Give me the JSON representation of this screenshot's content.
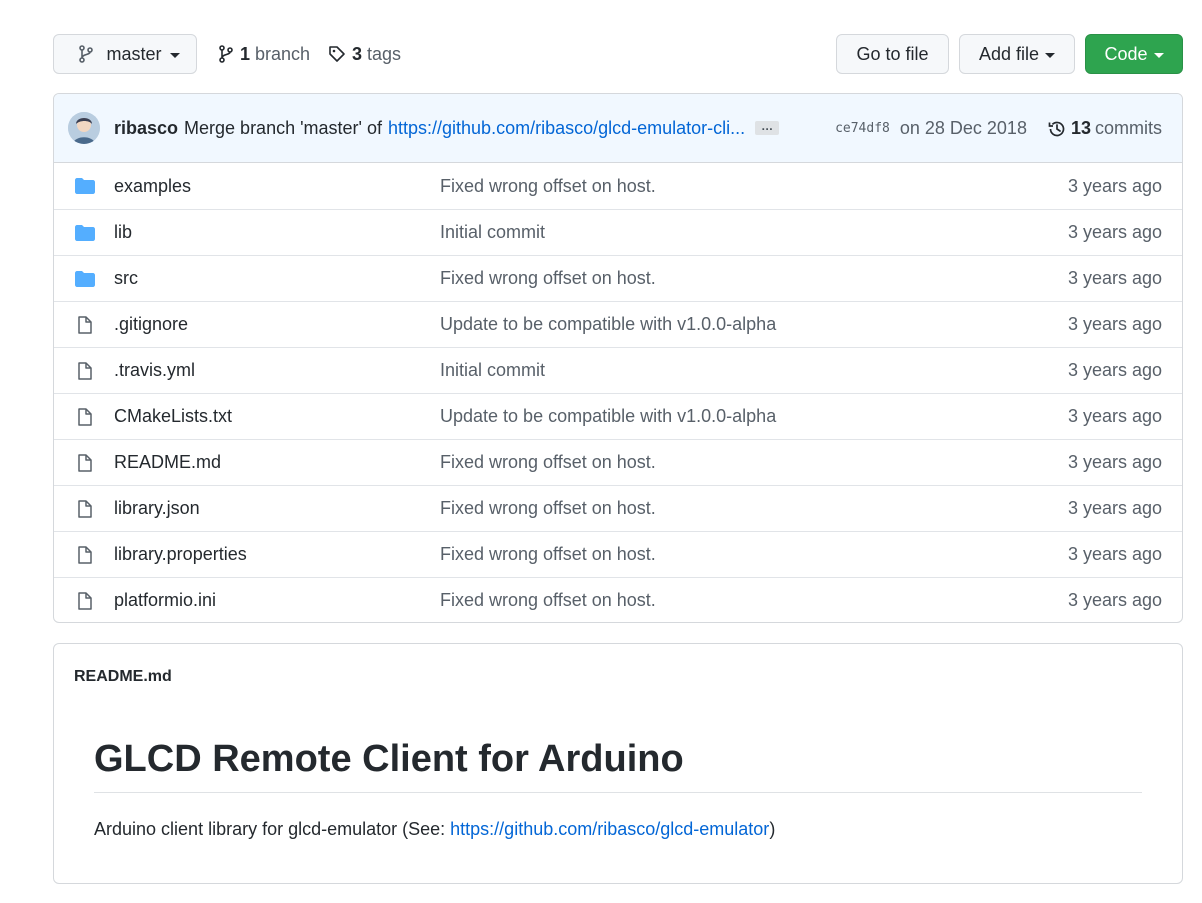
{
  "toolbar": {
    "branch_label": "master",
    "branches_count": "1",
    "branches_label": "branch",
    "tags_count": "3",
    "tags_label": "tags",
    "goto_label": "Go to file",
    "addfile_label": "Add file",
    "code_label": "Code"
  },
  "commit": {
    "author": "ribasco",
    "message": "Merge branch 'master' of",
    "link": "https://github.com/ribasco/glcd-emulator-cli...",
    "ellipsis": "…",
    "sha": "ce74df8",
    "date": "on 28 Dec 2018",
    "commits_count": "13",
    "commits_label": "commits"
  },
  "files": [
    {
      "type": "dir",
      "name": "examples",
      "commit": "Fixed wrong offset on host.",
      "age": "3 years ago"
    },
    {
      "type": "dir",
      "name": "lib",
      "commit": "Initial commit",
      "age": "3 years ago"
    },
    {
      "type": "dir",
      "name": "src",
      "commit": "Fixed wrong offset on host.",
      "age": "3 years ago"
    },
    {
      "type": "file",
      "name": ".gitignore",
      "commit": "Update to be compatible with v1.0.0-alpha",
      "age": "3 years ago"
    },
    {
      "type": "file",
      "name": ".travis.yml",
      "commit": "Initial commit",
      "age": "3 years ago"
    },
    {
      "type": "file",
      "name": "CMakeLists.txt",
      "commit": "Update to be compatible with v1.0.0-alpha",
      "age": "3 years ago"
    },
    {
      "type": "file",
      "name": "README.md",
      "commit": "Fixed wrong offset on host.",
      "age": "3 years ago"
    },
    {
      "type": "file",
      "name": "library.json",
      "commit": "Fixed wrong offset on host.",
      "age": "3 years ago"
    },
    {
      "type": "file",
      "name": "library.properties",
      "commit": "Fixed wrong offset on host.",
      "age": "3 years ago"
    },
    {
      "type": "file",
      "name": "platformio.ini",
      "commit": "Fixed wrong offset on host.",
      "age": "3 years ago"
    }
  ],
  "readme": {
    "header": "README.md",
    "title": "GLCD Remote Client for Arduino",
    "text_prefix": "Arduino client library for glcd-emulator (See: ",
    "link": "https://github.com/ribasco/glcd-emulator",
    "text_suffix": ")"
  },
  "colors": {
    "accent_link": "#0366d6",
    "code_button": "#2ea44f",
    "folder_icon": "#54aeff"
  }
}
